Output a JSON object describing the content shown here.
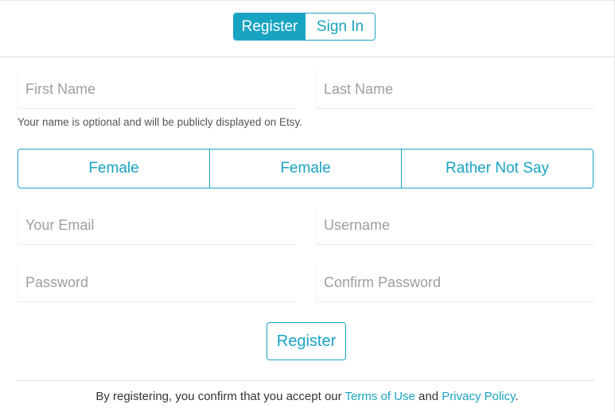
{
  "header": {
    "tabs": [
      {
        "label": "Register",
        "active": true
      },
      {
        "label": "Sign In",
        "active": false
      }
    ]
  },
  "form": {
    "first_name": {
      "placeholder": "First Name",
      "value": ""
    },
    "last_name": {
      "placeholder": "Last Name",
      "value": ""
    },
    "name_helper": "Your name is optional and will be publicly displayed on Etsy.",
    "gender_options": [
      "Female",
      "Female",
      "Rather Not Say"
    ],
    "email": {
      "placeholder": "Your Email",
      "value": ""
    },
    "username": {
      "placeholder": "Username",
      "value": ""
    },
    "password": {
      "placeholder": "Password",
      "value": ""
    },
    "confirm_password": {
      "placeholder": "Confirm Password",
      "value": ""
    },
    "submit_label": "Register"
  },
  "footer": {
    "text_before": "By registering, you confirm that you accept our ",
    "terms_link": "Terms of Use",
    "text_middle": " and ",
    "privacy_link": "Privacy Policy",
    "text_after": "."
  },
  "colors": {
    "accent": "#19a3c3",
    "text": "#333333",
    "placeholder": "#9e9e9e"
  }
}
